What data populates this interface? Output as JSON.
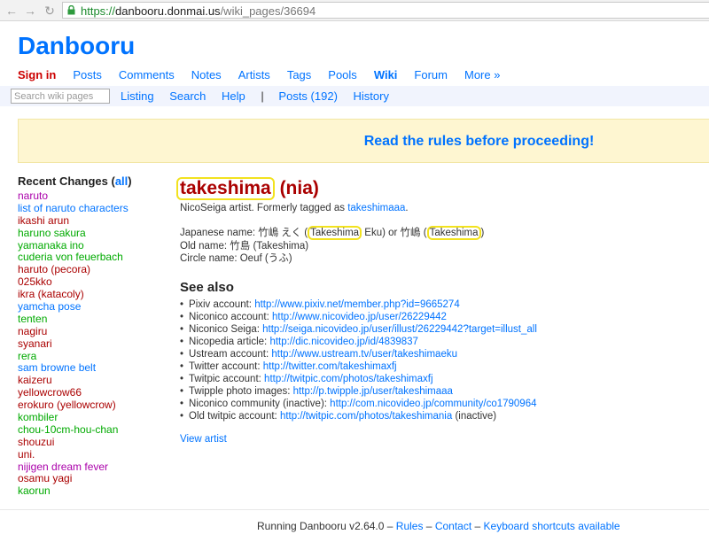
{
  "browser": {
    "scheme": "https://",
    "host": "danbooru.donmai.us",
    "path": "/wiki_pages/36694"
  },
  "header": {
    "logo": "Danbooru",
    "nav": [
      {
        "label": "Sign in",
        "kind": "signin"
      },
      {
        "label": "Posts",
        "kind": "normal"
      },
      {
        "label": "Comments",
        "kind": "normal"
      },
      {
        "label": "Notes",
        "kind": "normal"
      },
      {
        "label": "Artists",
        "kind": "normal"
      },
      {
        "label": "Tags",
        "kind": "normal"
      },
      {
        "label": "Pools",
        "kind": "normal"
      },
      {
        "label": "Wiki",
        "kind": "active"
      },
      {
        "label": "Forum",
        "kind": "normal"
      },
      {
        "label": "More »",
        "kind": "normal"
      }
    ],
    "search_placeholder": "Search wiki pages",
    "subnav": {
      "listing": "Listing",
      "search": "Search",
      "help": "Help",
      "separator": "|",
      "posts": "Posts (192)",
      "history": "History"
    }
  },
  "notice": "Read the rules before proceeding!",
  "sidebar": {
    "heading_prefix": "Recent Changes (",
    "heading_link": "all",
    "heading_suffix": ")",
    "items": [
      {
        "label": "naruto",
        "cls": "c-copy"
      },
      {
        "label": "list of naruto characters",
        "cls": "c-gen"
      },
      {
        "label": "ikashi arun",
        "cls": "c-art"
      },
      {
        "label": "haruno sakura",
        "cls": "c-char"
      },
      {
        "label": "yamanaka ino",
        "cls": "c-char"
      },
      {
        "label": "cuderia von feuerbach",
        "cls": "c-char"
      },
      {
        "label": "haruto (pecora)",
        "cls": "c-art"
      },
      {
        "label": "025kko",
        "cls": "c-art"
      },
      {
        "label": "ikra (katacoly)",
        "cls": "c-art"
      },
      {
        "label": "yamcha pose",
        "cls": "c-gen"
      },
      {
        "label": "tenten",
        "cls": "c-char"
      },
      {
        "label": "nagiru",
        "cls": "c-art"
      },
      {
        "label": "syanari",
        "cls": "c-art"
      },
      {
        "label": "rera",
        "cls": "c-char"
      },
      {
        "label": "sam browne belt",
        "cls": "c-gen"
      },
      {
        "label": "kaizeru",
        "cls": "c-art"
      },
      {
        "label": "yellowcrow66",
        "cls": "c-art"
      },
      {
        "label": "erokuro (yellowcrow)",
        "cls": "c-art"
      },
      {
        "label": "kombiler",
        "cls": "c-char"
      },
      {
        "label": "chou-10cm-hou-chan",
        "cls": "c-char"
      },
      {
        "label": "shouzui",
        "cls": "c-art"
      },
      {
        "label": "uni.",
        "cls": "c-art"
      },
      {
        "label": "nijigen dream fever",
        "cls": "c-copy"
      },
      {
        "label": "osamu yagi",
        "cls": "c-art"
      },
      {
        "label": "kaorun",
        "cls": "c-char"
      }
    ]
  },
  "main": {
    "title_main": "takeshima",
    "title_suffix": " (nia)",
    "intro_text": "NicoSeiga artist. Formerly tagged as ",
    "intro_link": "takeshimaaa",
    "intro_end": ".",
    "japanese_prefix": "Japanese name: 竹嶋 えく (",
    "japanese_hl1": "Takeshima",
    "japanese_mid": " Eku) or 竹嶋 (",
    "japanese_hl2": "Takeshima",
    "japanese_end": ")",
    "old_name": "Old name: 竹島 (Takeshima)",
    "circle_name": "Circle name: Oeuf (うふ)",
    "see_also": "See also",
    "links": [
      {
        "label": "Pixiv account: ",
        "url": "http://www.pixiv.net/member.php?id=9665274",
        "note": ""
      },
      {
        "label": "Niconico account: ",
        "url": "http://www.nicovideo.jp/user/26229442",
        "note": ""
      },
      {
        "label": "Niconico Seiga: ",
        "url": "http://seiga.nicovideo.jp/user/illust/26229442?target=illust_all",
        "note": ""
      },
      {
        "label": "Nicopedia article: ",
        "url": "http://dic.nicovideo.jp/id/4839837",
        "note": ""
      },
      {
        "label": "Ustream account: ",
        "url": "http://www.ustream.tv/user/takeshimaeku",
        "note": ""
      },
      {
        "label": "Twitter account: ",
        "url": "http://twitter.com/takeshimaxfj",
        "note": ""
      },
      {
        "label": "Twitpic account: ",
        "url": "http://twitpic.com/photos/takeshimaxfj",
        "note": ""
      },
      {
        "label": "Twipple photo images: ",
        "url": "http://p.twipple.jp/user/takeshimaaa",
        "note": ""
      },
      {
        "label": "Niconico community (inactive): ",
        "url": "http://com.nicovideo.jp/community/co1790964",
        "note": ""
      },
      {
        "label": "Old twitpic account: ",
        "url": "http://twitpic.com/photos/takeshimania",
        "note": " (inactive)"
      }
    ],
    "view_artist": "View artist"
  },
  "footer": {
    "running": "Running Danbooru v2.64.0",
    "dash": " – ",
    "rules": "Rules",
    "contact": "Contact",
    "shortcuts": "Keyboard shortcuts available"
  },
  "colors": {
    "link": "#0073ff",
    "artist": "#aa0000",
    "highlight": "#f2e21f",
    "notice_bg": "#fef6d1"
  }
}
